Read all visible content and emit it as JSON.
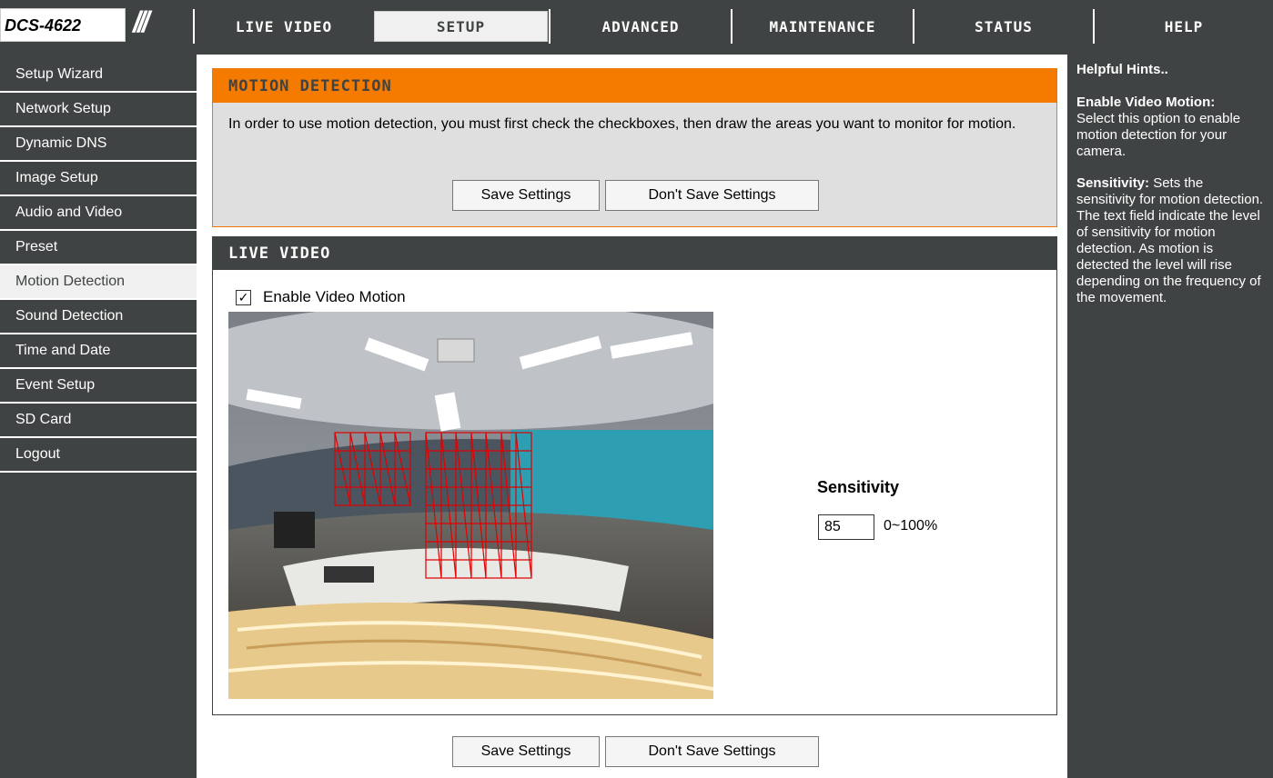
{
  "brand": {
    "model": "DCS-4622",
    "slashes": "///"
  },
  "nav": {
    "tabs": [
      "LIVE VIDEO",
      "SETUP",
      "ADVANCED",
      "MAINTENANCE",
      "STATUS",
      "HELP"
    ],
    "active": "SETUP"
  },
  "sidebar": {
    "items": [
      {
        "label": "Setup Wizard"
      },
      {
        "label": "Network Setup"
      },
      {
        "label": "Dynamic DNS"
      },
      {
        "label": "Image Setup"
      },
      {
        "label": "Audio and Video"
      },
      {
        "label": "Preset"
      },
      {
        "label": "Motion Detection"
      },
      {
        "label": "Sound Detection"
      },
      {
        "label": "Time and Date"
      },
      {
        "label": "Event Setup"
      },
      {
        "label": "SD Card"
      },
      {
        "label": "Logout"
      }
    ],
    "active": "Motion Detection"
  },
  "motion": {
    "title": "MOTION DETECTION",
    "description": "In order to use motion detection, you must first check the checkboxes, then draw the areas you want to monitor for motion.",
    "save_label": "Save Settings",
    "dont_save_label": "Don't Save Settings"
  },
  "live": {
    "title": "LIVE VIDEO",
    "enable_label": "Enable Video Motion",
    "enable_checked": true,
    "sensitivity_label": "Sensitivity",
    "sensitivity_value": "85",
    "sensitivity_range": "0~100%"
  },
  "footer": {
    "save_label": "Save Settings",
    "dont_save_label": "Don't Save Settings"
  },
  "help": {
    "title": "Helpful Hints..",
    "enable_heading": "Enable Video Motion:",
    "enable_text": "Select this option to enable motion detection for your camera.",
    "sens_heading": "Sensitivity:",
    "sens_text": "Sets the sensitivity for motion detection. The text field indicate the level of sensitivity for motion detection. As motion is detected the level will rise depending on the frequency of the movement."
  }
}
